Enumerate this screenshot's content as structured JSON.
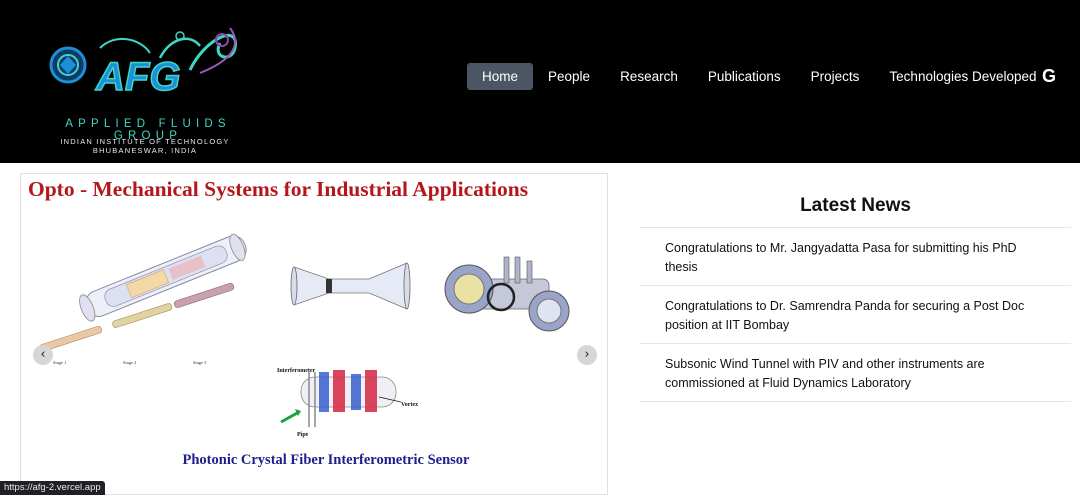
{
  "logo": {
    "icon": "afg-logo-icon",
    "mark": "AFG",
    "group": "APPLIED FLUIDS GROUP",
    "institute_line1": "INDIAN INSTITUTE OF TECHNOLOGY",
    "institute_line2": "BHUBANESWAR, INDIA"
  },
  "nav": {
    "items": [
      "Home",
      "People",
      "Research",
      "Publications",
      "Projects",
      "Technologies Developed"
    ],
    "active": "Home",
    "google_icon": "google-icon",
    "google_label": "G"
  },
  "carousel": {
    "title": "Opto - Mechanical Systems for Industrial Applications",
    "caption": "Photonic Crystal Fiber Interferometric Sensor",
    "figure_labels": {
      "stage1": "Stage 1",
      "stage2": "Stage 2",
      "stage3": "Stage 3",
      "interferometer": "Interferometer",
      "vortex": "Vortex",
      "pipe": "Pipe"
    },
    "prev_icon": "chevron-left-icon",
    "next_icon": "chevron-right-icon",
    "prev_label": "‹",
    "next_label": "›"
  },
  "news": {
    "heading": "Latest News",
    "items": [
      "Congratulations to Mr. Jangyadatta Pasa for submitting his PhD thesis",
      "Congratulations to Dr. Samrendra Panda for securing a Post Doc position at IIT Bombay",
      "Subsonic Wind Tunnel with PIV and other instruments are commissioned at Fluid Dynamics Laboratory"
    ]
  },
  "status_bar": {
    "url": "https://afg-2.vercel.app"
  },
  "colors": {
    "header_bg": "#000000",
    "nav_active_bg": "#4b5563",
    "slide_title": "#b3171b",
    "slide_caption": "#1e1e8c",
    "logo_teal": "#3fd6c8",
    "logo_blue": "#1c8fd6"
  }
}
